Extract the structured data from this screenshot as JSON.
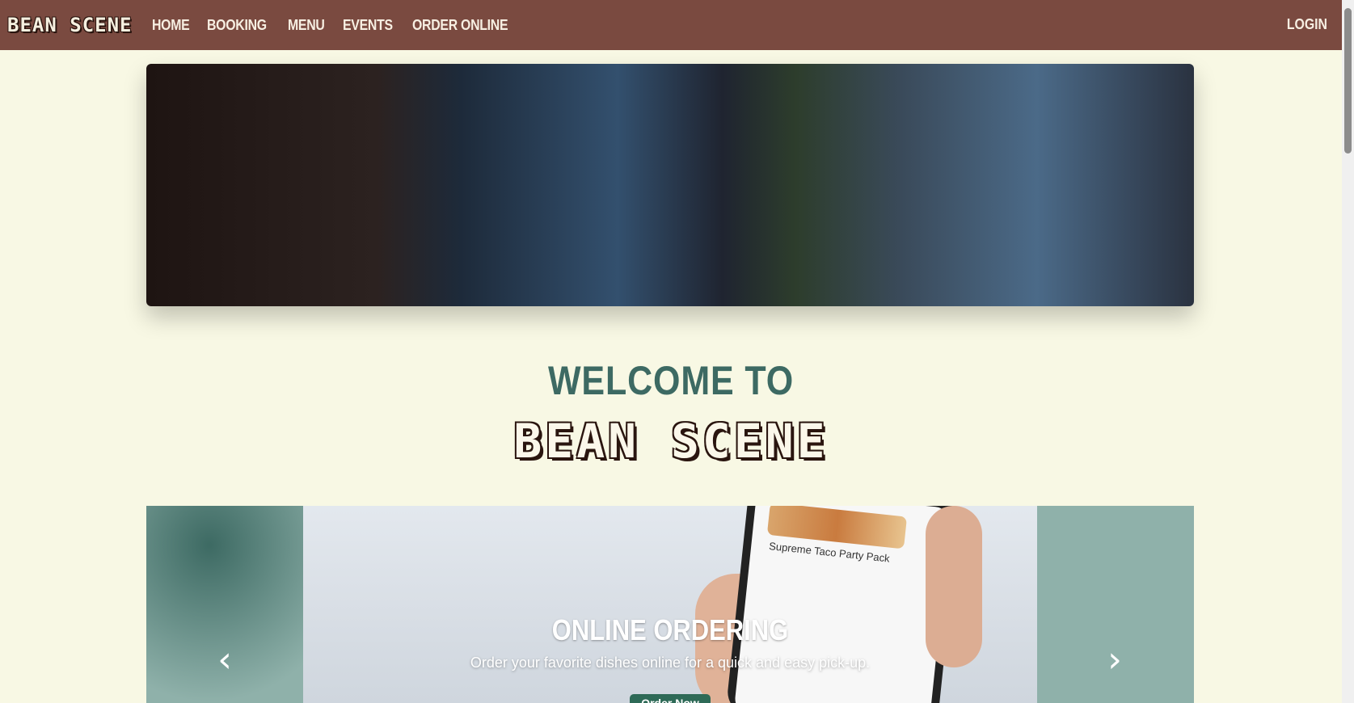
{
  "navbar": {
    "brand": "BEAN SCENE",
    "links": [
      "HOME",
      "BOOKING",
      "MENU",
      "EVENTS",
      "ORDER ONLINE"
    ],
    "login": "LOGIN"
  },
  "welcome": {
    "line1": "WELCOME TO",
    "line2": "BEAN SCENE"
  },
  "carousel": {
    "slide": {
      "phone_text": "Supreme Taco Party Pack",
      "title": "ONLINE ORDERING",
      "description": "Order your favorite dishes online for a quick and easy pick-up.",
      "button": "Order Now"
    },
    "prev_icon": "chevron-left-icon",
    "next_icon": "chevron-right-icon"
  },
  "colors": {
    "navbar_bg": "#7a4a40",
    "page_bg": "#f8f8e4",
    "heading_teal": "#3d6a63",
    "button_green": "#2e6a57"
  }
}
